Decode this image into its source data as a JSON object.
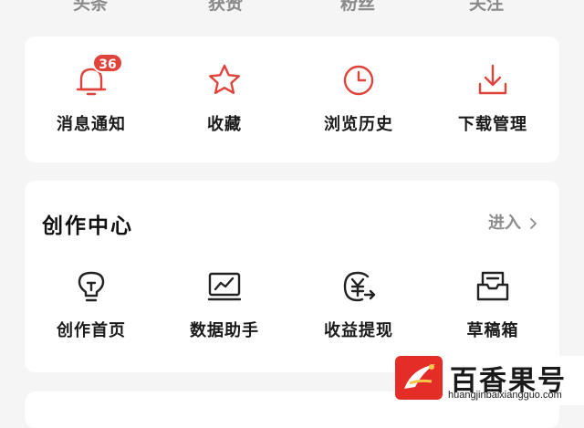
{
  "stats": [
    {
      "label": "头条"
    },
    {
      "label": "获赞"
    },
    {
      "label": "粉丝"
    },
    {
      "label": "关注"
    }
  ],
  "quick_actions": [
    {
      "label": "消息通知",
      "icon": "bell-icon",
      "badge": "36"
    },
    {
      "label": "收藏",
      "icon": "star-icon"
    },
    {
      "label": "浏览历史",
      "icon": "clock-icon"
    },
    {
      "label": "下载管理",
      "icon": "download-icon"
    }
  ],
  "creator": {
    "title": "创作中心",
    "enter_label": "进入",
    "items": [
      {
        "label": "创作首页",
        "icon": "lightbulb-icon"
      },
      {
        "label": "数据助手",
        "icon": "chart-monitor-icon"
      },
      {
        "label": "收益提现",
        "icon": "yuan-withdraw-icon"
      },
      {
        "label": "草稿箱",
        "icon": "drafts-tray-icon"
      }
    ]
  },
  "watermark": {
    "title": "百香果号",
    "domain": "huangjinbaixiangguo.com"
  },
  "colors": {
    "accent_red": "#e0433a",
    "icon_dark": "#222222",
    "background": "#f5f5f5",
    "card": "#ffffff"
  }
}
